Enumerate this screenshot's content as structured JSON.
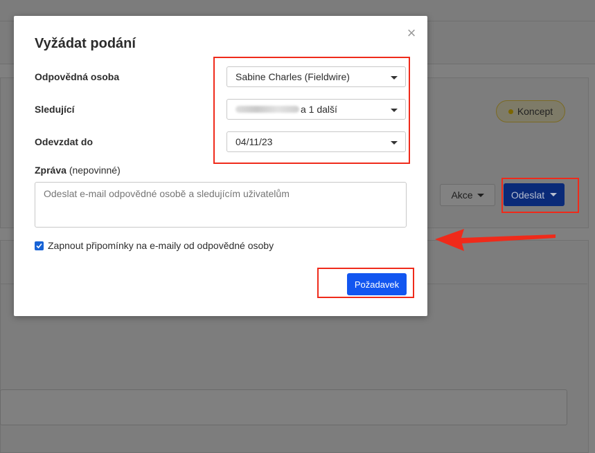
{
  "background": {
    "status_badge": "Koncept",
    "actions_button": "Akce",
    "send_button": "Odeslat"
  },
  "modal": {
    "title": "Vyžádat podání",
    "fields": {
      "responsible_label": "Odpovědná osoba",
      "responsible_value": "Sabine Charles (Fieldwire)",
      "followers_label": "Sledující",
      "followers_value": "a 1 další",
      "due_label": "Odevzdat do",
      "due_value": "04/11/23"
    },
    "message": {
      "label": "Zpráva",
      "label_optional": "(nepovinné)",
      "placeholder": "Odeslat e-mail odpovědné osobě a sledujícím uživatelům"
    },
    "reminder_label": "Zapnout připomínky na e-maily od odpovědné osoby",
    "reminder_checked": true,
    "submit_label": "Požadavek"
  },
  "colors": {
    "highlight": "#ef2a1a",
    "primary_button": "#1256f0",
    "checkbox": "#1763d6"
  }
}
